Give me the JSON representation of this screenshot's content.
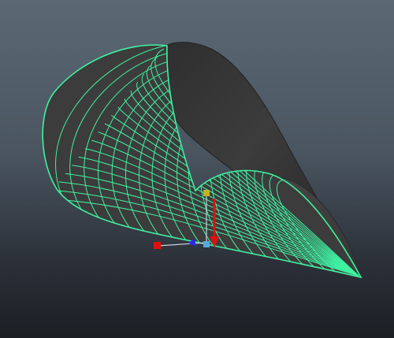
{
  "viewport": {
    "background_top": "#5b6874",
    "background_bottom": "#1c1f24",
    "selected_object": "surface-mesh",
    "display_mode": "wireframe-on-shaded"
  },
  "mesh": {
    "wire_color": "#3ff2a2",
    "shaded_color": "#3a3a3a",
    "icon": "conical-surface-icon"
  },
  "manipulator": {
    "icon": "move-tool-manipulator-icon",
    "colors": {
      "x_axis": "#e01010",
      "y_axis": "#e01010",
      "z_axis": "#2a2ae0",
      "center": "#59a8e0",
      "pivot": "#c8b020"
    }
  }
}
